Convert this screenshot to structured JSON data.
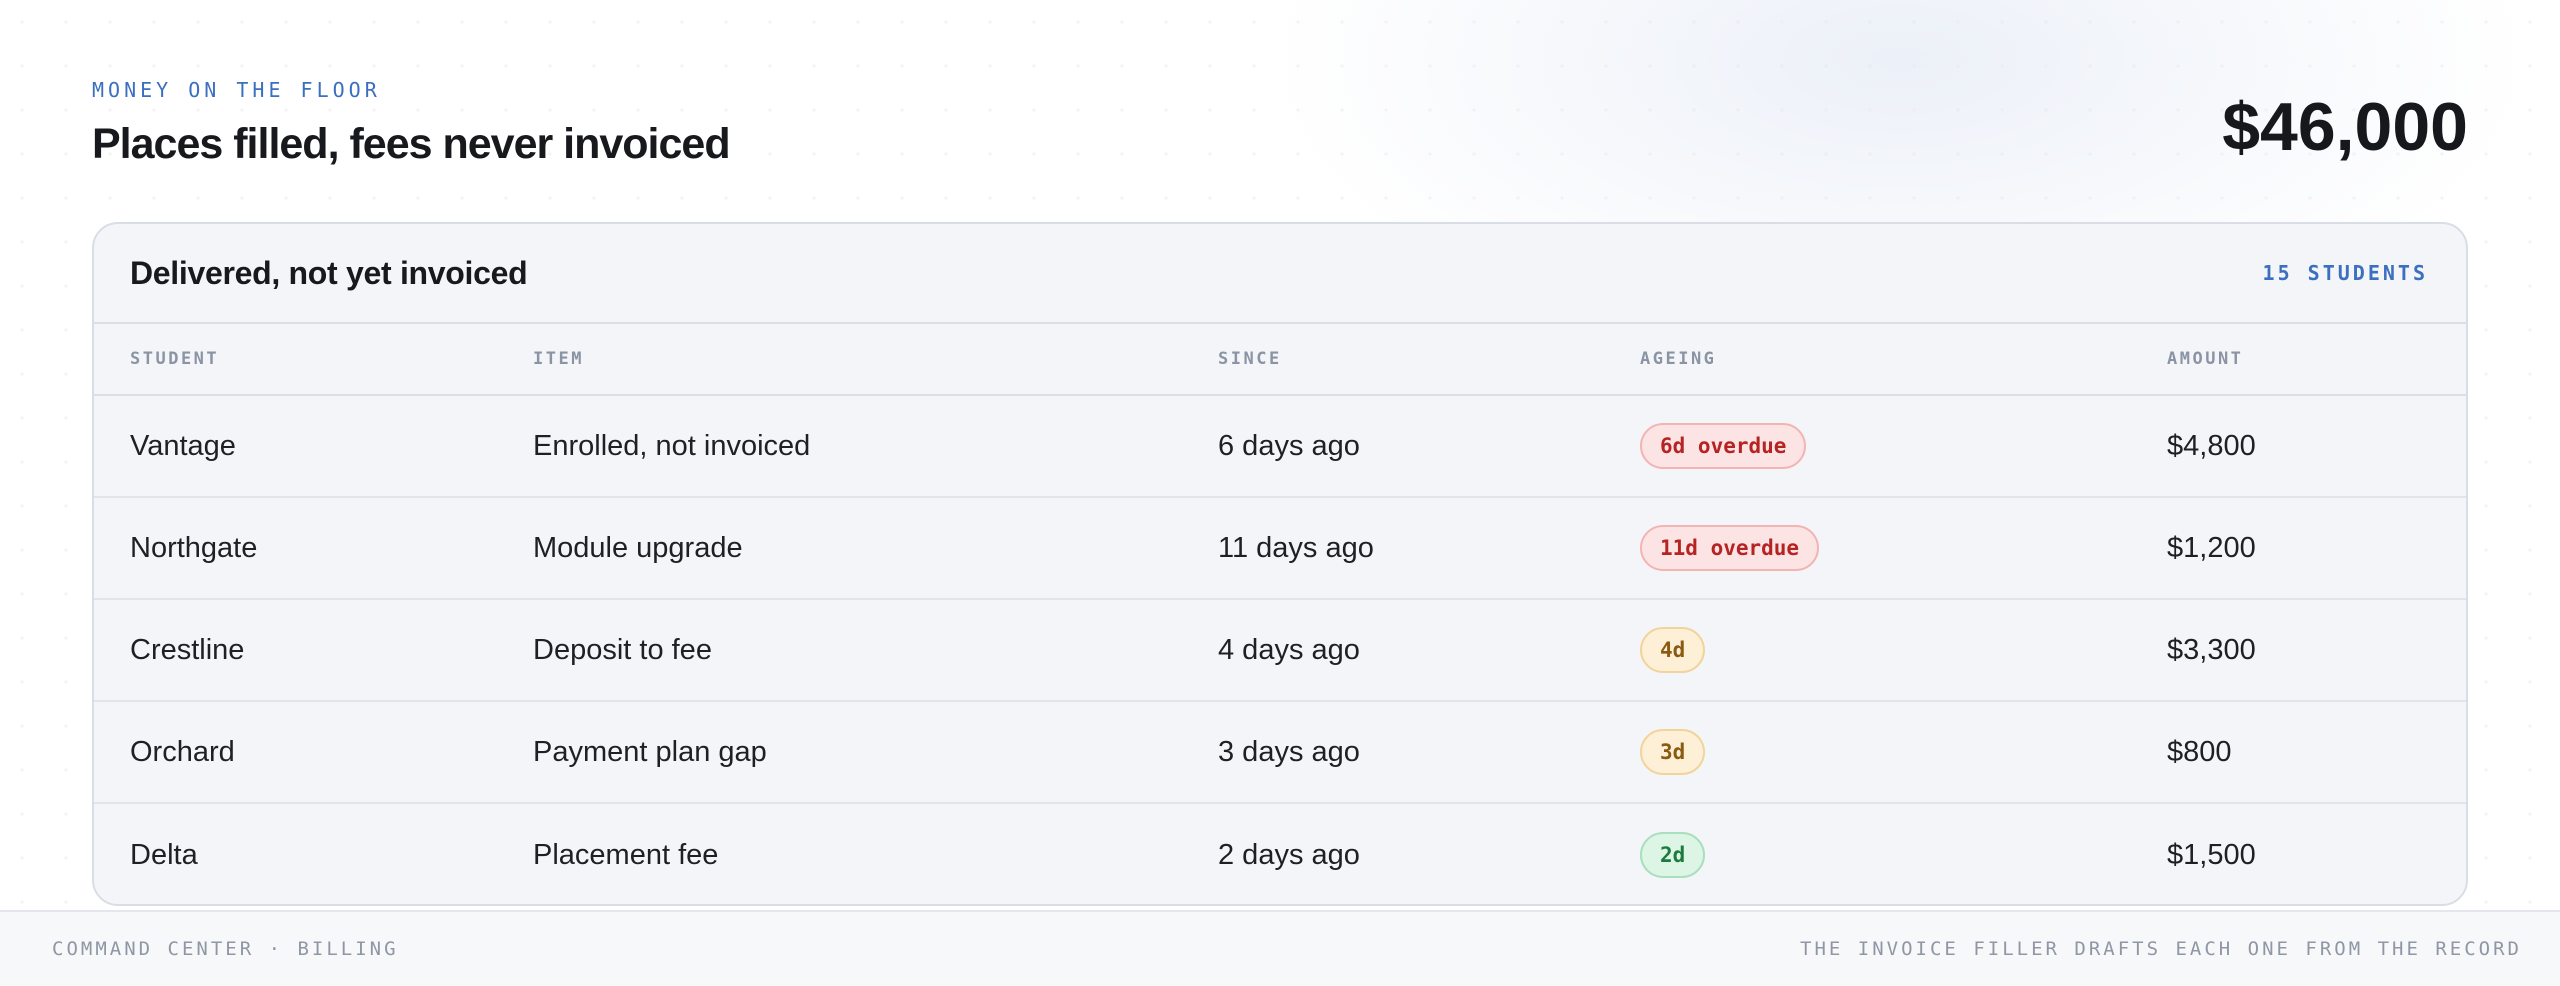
{
  "header": {
    "eyebrow": "MONEY ON THE FLOOR",
    "title": "Places filled, fees never invoiced",
    "total": "$46,000"
  },
  "card": {
    "title": "Delivered, not yet invoiced",
    "count": "15 STUDENTS",
    "columns": [
      "STUDENT",
      "ITEM",
      "SINCE",
      "AGEING",
      "AMOUNT"
    ],
    "rows": [
      {
        "student": "Vantage",
        "item": "Enrolled, not invoiced",
        "since": "6 days ago",
        "ageing": "6d overdue",
        "status": "red",
        "amount": "$4,800"
      },
      {
        "student": "Northgate",
        "item": "Module upgrade",
        "since": "11 days ago",
        "ageing": "11d overdue",
        "status": "red",
        "amount": "$1,200"
      },
      {
        "student": "Crestline",
        "item": "Deposit to fee",
        "since": "4 days ago",
        "ageing": "4d",
        "status": "amber",
        "amount": "$3,300"
      },
      {
        "student": "Orchard",
        "item": "Payment plan gap",
        "since": "3 days ago",
        "ageing": "3d",
        "status": "amber",
        "amount": "$800"
      },
      {
        "student": "Delta",
        "item": "Placement fee",
        "since": "2 days ago",
        "ageing": "2d",
        "status": "green",
        "amount": "$1,500"
      }
    ]
  },
  "footer": {
    "left": "COMMAND CENTER · BILLING",
    "right": "THE INVOICE FILLER DRAFTS EACH ONE FROM THE RECORD"
  },
  "colors": {
    "accent": "#3b6fc0",
    "overdue": "#b52323",
    "warning": "#8a5a10",
    "ok": "#1d7a3f"
  }
}
